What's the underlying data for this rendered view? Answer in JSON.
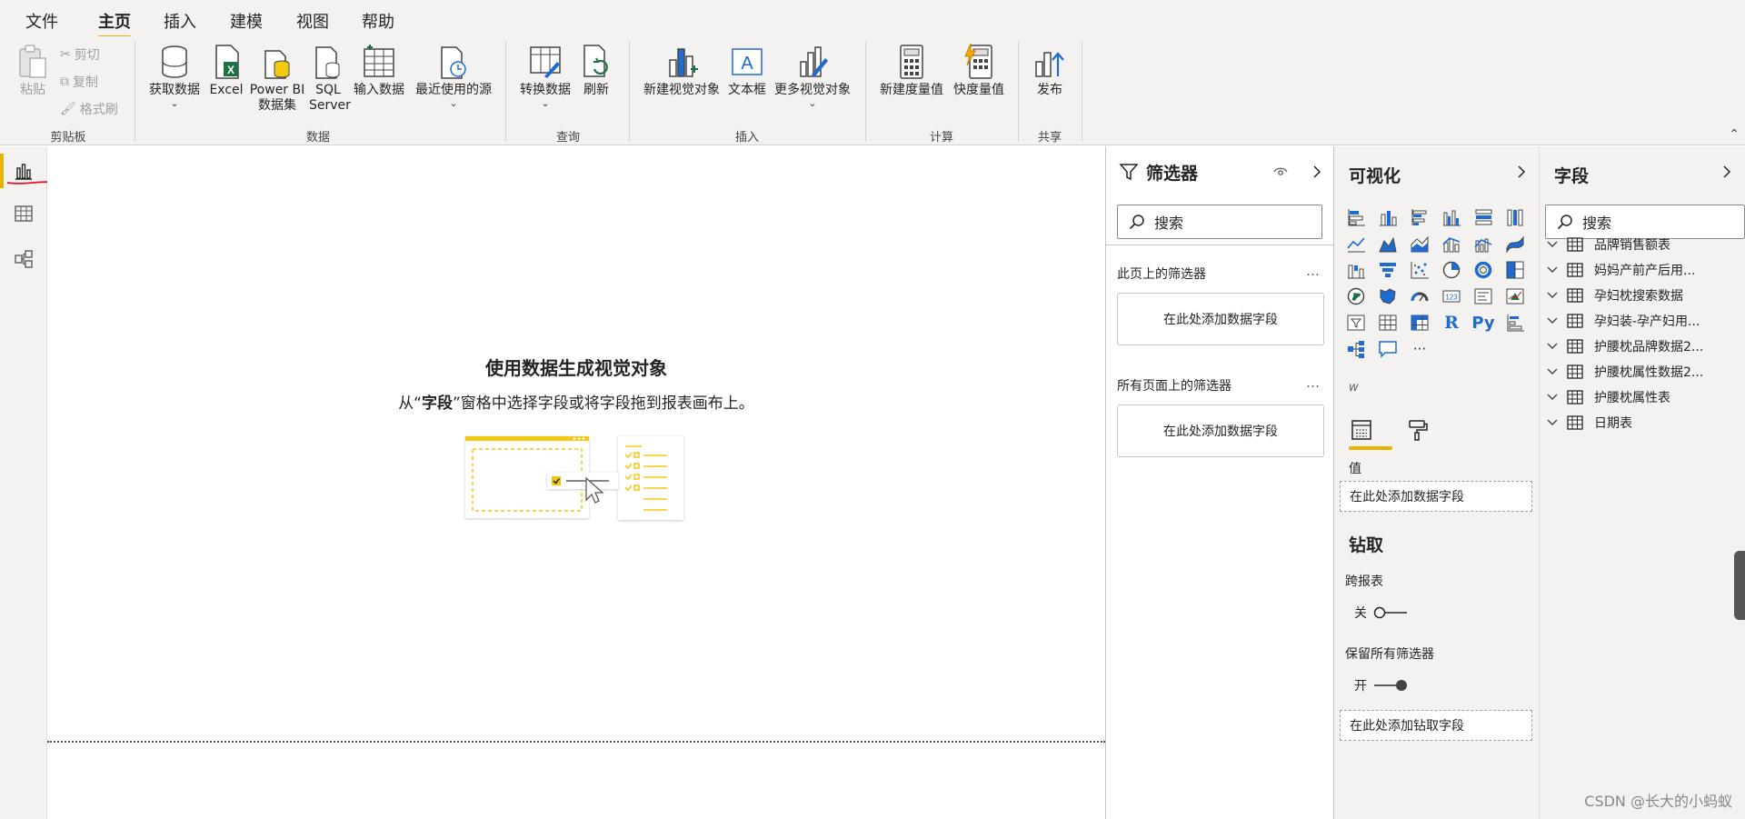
{
  "menu": {
    "tabs": [
      {
        "label": "文件"
      },
      {
        "label": "主页"
      },
      {
        "label": "插入"
      },
      {
        "label": "建模"
      },
      {
        "label": "视图"
      },
      {
        "label": "帮助"
      }
    ],
    "active": "主页"
  },
  "ribbon": {
    "clipboard": {
      "paste": "粘贴",
      "cut": "剪切",
      "copy": "复制",
      "format_painter": "格式刷",
      "group": "剪贴板"
    },
    "data": {
      "get_data": "获取数据",
      "excel": "Excel",
      "powerbi_line1": "Power BI",
      "powerbi_line2": "数据集",
      "sql_line1": "SQL",
      "sql_line2": "Server",
      "enter_data": "输入数据",
      "recent_sources": "最近使用的源",
      "group": "数据"
    },
    "queries": {
      "transform": "转换数据",
      "refresh": "刷新",
      "group": "查询"
    },
    "insert": {
      "new_visual": "新建视觉对象",
      "text_box": "文本框",
      "more_visuals": "更多视觉对象",
      "group": "插入"
    },
    "calculations": {
      "new_measure": "新建度量值",
      "quick_measure": "快度量值",
      "group": "计算"
    },
    "share": {
      "publish": "发布",
      "group": "共享"
    },
    "chevron": "⌄",
    "collapse": "⌃"
  },
  "canvas": {
    "title": "使用数据生成视觉对象",
    "sub_prefix": "从“",
    "sub_bold": "字段",
    "sub_suffix": "”窗格中选择字段或将字段拖到报表画布上。"
  },
  "filters": {
    "title": "筛选器",
    "search_placeholder": "搜索",
    "this_page": "此页上的筛选器",
    "all_pages": "所有页面上的筛选器",
    "add_field": "在此处添加数据字段",
    "more": "…"
  },
  "visualizations": {
    "title": "可视化",
    "r_label": "R",
    "py_label": "Py",
    "more": "···",
    "w_label": "w",
    "values_label": "值",
    "values_drop": "在此处添加数据字段",
    "drill_title": "钻取",
    "cross_report": "跨报表",
    "cross_report_state": "关",
    "keep_filters": "保留所有筛选器",
    "keep_filters_state": "开",
    "drill_drop": "在此处添加钻取字段"
  },
  "fields": {
    "title": "字段",
    "search_placeholder": "搜索",
    "tables": [
      {
        "label": "品牌销售额表"
      },
      {
        "label": "妈妈产前产后用..."
      },
      {
        "label": "孕妇枕搜索数据"
      },
      {
        "label": "孕妇装-孕产妇用..."
      },
      {
        "label": "护腰枕品牌数据2..."
      },
      {
        "label": "护腰枕属性数据2..."
      },
      {
        "label": "护腰枕属性表"
      },
      {
        "label": "日期表"
      }
    ]
  },
  "watermark": "CSDN @长大的小蚂蚁",
  "colors": {
    "accent": "#e8b300",
    "ribbon_bg": "#f3f2f1",
    "excel_green": "#1e7145",
    "icon_blue": "#1f6bd1",
    "annotation_red": "#e81123"
  }
}
